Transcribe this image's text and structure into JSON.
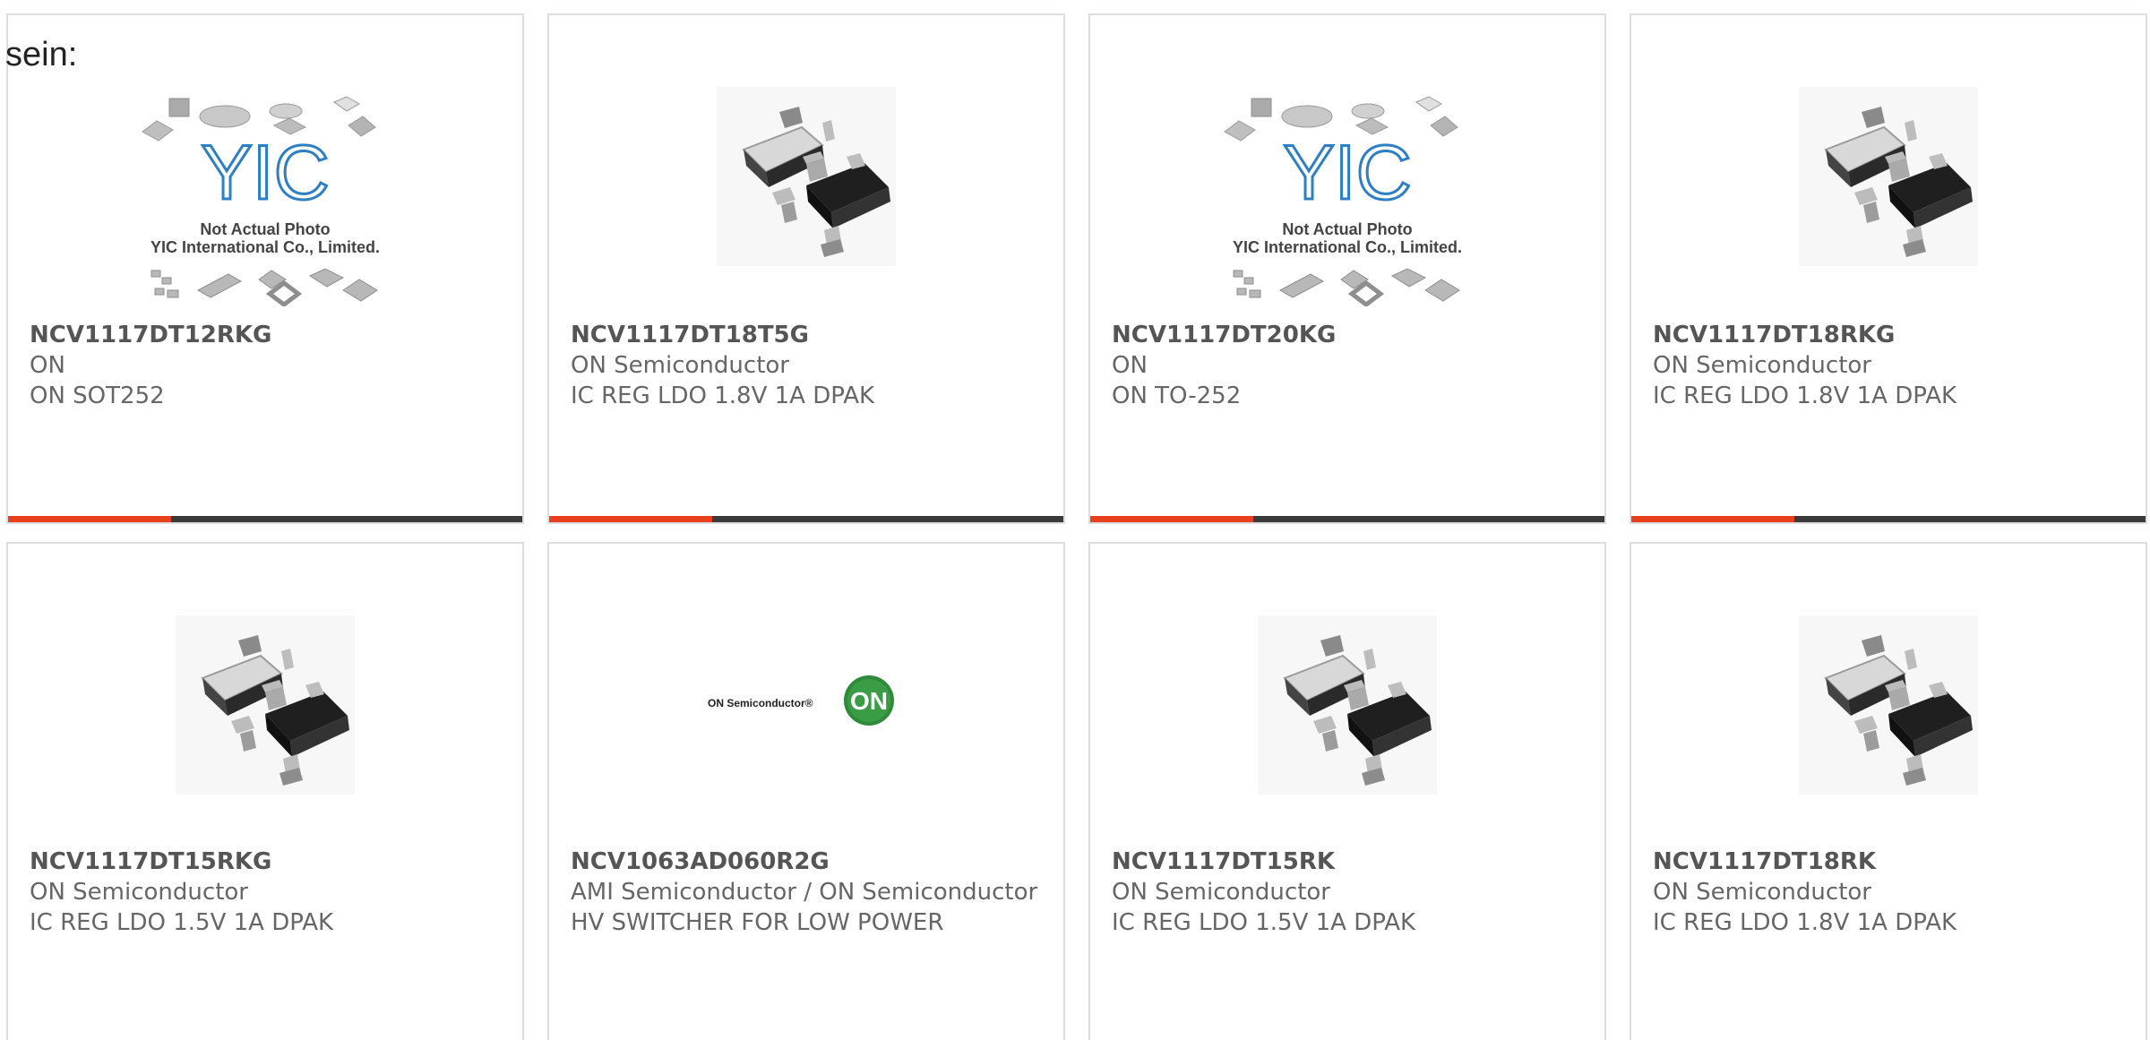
{
  "heading": "sein:",
  "colors": {
    "accent": "#e8401c",
    "bar": "#3a3a3a",
    "border": "#dddddd",
    "text": "#666666",
    "on_logo_green": "#2f8a3a"
  },
  "yic_placeholder": {
    "brand": "YIC",
    "line1": "Not Actual Photo",
    "line2": "YIC International Co., Limited."
  },
  "on_logo": {
    "wordmark": "ON Semiconductor",
    "badge": "ON"
  },
  "products": [
    {
      "part": "NCV1117DT12RKG",
      "maker": "ON",
      "desc": "ON SOT252",
      "image": "yic-placeholder-icon"
    },
    {
      "part": "NCV1117DT18T5G",
      "maker": "ON Semiconductor",
      "desc": "IC REG LDO 1.8V 1A DPAK",
      "image": "dpak-package-icon"
    },
    {
      "part": "NCV1117DT20KG",
      "maker": "ON",
      "desc": "ON TO-252",
      "image": "yic-placeholder-icon"
    },
    {
      "part": "NCV1117DT18RKG",
      "maker": "ON Semiconductor",
      "desc": "IC REG LDO 1.8V 1A DPAK",
      "image": "dpak-package-icon"
    },
    {
      "part": "NCV1117DT15RKG",
      "maker": "ON Semiconductor",
      "desc": "IC REG LDO 1.5V 1A DPAK",
      "image": "dpak-package-icon"
    },
    {
      "part": "NCV1063AD060R2G",
      "maker": "AMI Semiconductor / ON Semiconductor",
      "desc": "HV SWITCHER FOR LOW POWER",
      "image": "on-semiconductor-logo"
    },
    {
      "part": "NCV1117DT15RK",
      "maker": "ON Semiconductor",
      "desc": "IC REG LDO 1.5V 1A DPAK",
      "image": "dpak-package-icon"
    },
    {
      "part": "NCV1117DT18RK",
      "maker": "ON Semiconductor",
      "desc": "IC REG LDO 1.8V 1A DPAK",
      "image": "dpak-package-icon"
    }
  ]
}
